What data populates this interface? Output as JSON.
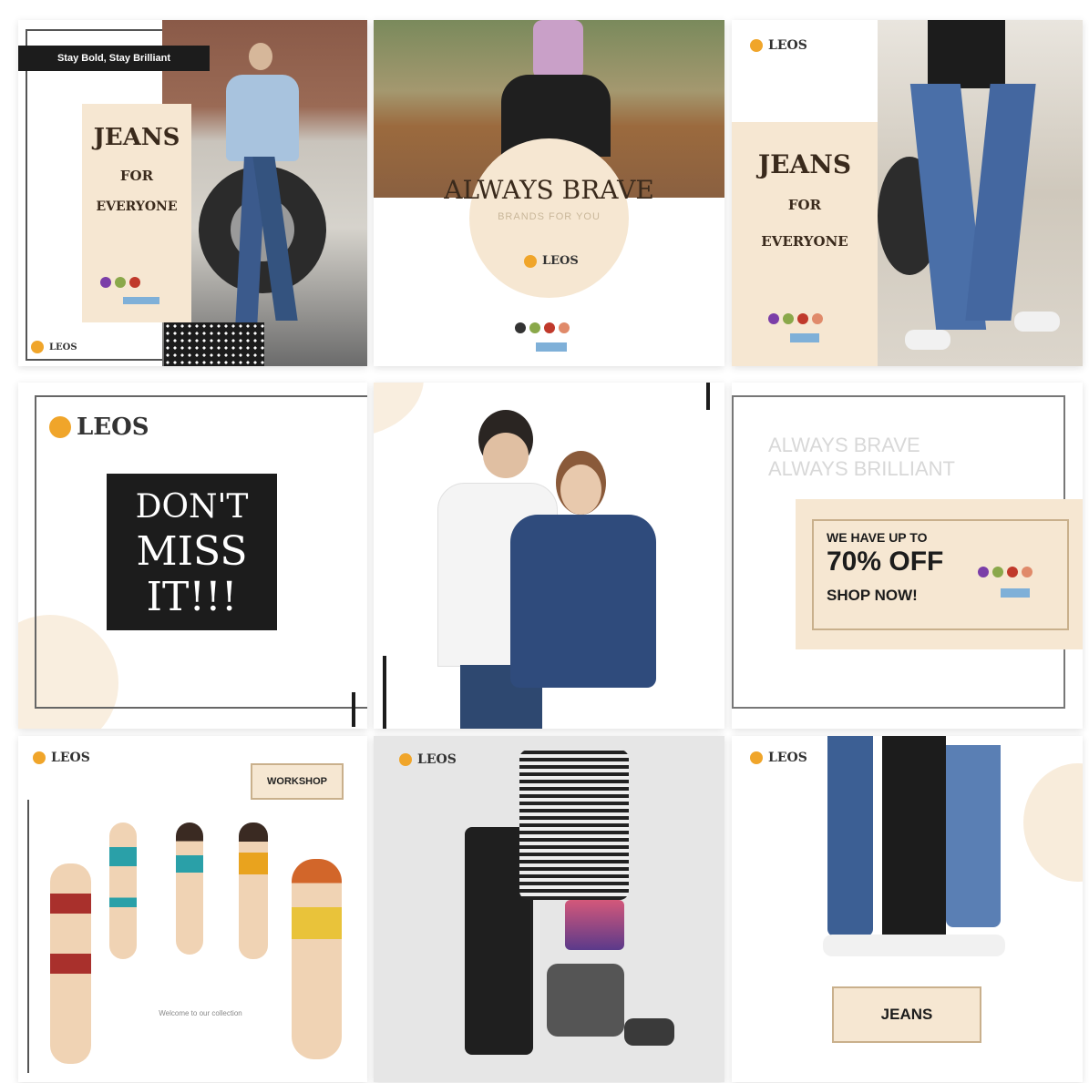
{
  "brand": "LEOS",
  "tiles": {
    "t1": {
      "tag": "Stay Bold, Stay Brilliant",
      "headline": "JEANS",
      "for": "FOR",
      "everyone": "EVERYONE"
    },
    "t2": {
      "headline": "ALWAYS BRAVE",
      "sub": "BRANDS FOR YOU"
    },
    "t3": {
      "headline": "JEANS",
      "for": "FOR",
      "everyone": "EVERYONE"
    },
    "t4": {
      "line1": "DON'T",
      "line2": "MISS",
      "line3": "IT!!!"
    },
    "t6": {
      "faded1": "ALWAYS BRAVE",
      "faded2": "ALWAYS BRILLIANT",
      "offer1": "WE HAVE UP TO",
      "offer2": "70% OFF",
      "offer3": "SHOP NOW!"
    },
    "t7": {
      "tag": "WORKSHOP",
      "caption": "Welcome to our collection"
    },
    "t9": {
      "tag": "JEANS"
    }
  },
  "colors": {
    "cream": "#f6e7d2",
    "accent": "#f0a52a",
    "denim": "#3b5a8c",
    "dark": "#1c1c1c"
  }
}
